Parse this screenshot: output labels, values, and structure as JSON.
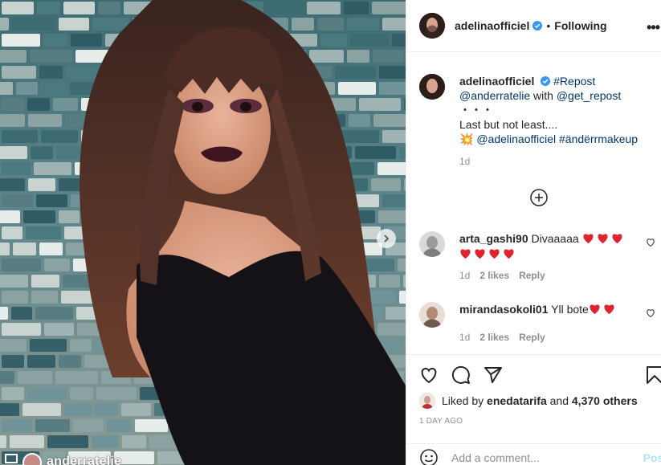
{
  "post": {
    "image_description_icon": "photo",
    "repost_credit": {
      "icon": "repost-icon",
      "username": "anderratelie"
    }
  },
  "header": {
    "username": "adelinaofficiel",
    "verified_icon": "verified-badge-icon",
    "separator": "•",
    "follow_status": "Following",
    "more_icon": "more-options-icon",
    "more_label": "•••"
  },
  "caption": {
    "username": "adelinaofficiel",
    "line1_tag": "#Repost",
    "line2_mention": "@anderratelie",
    "line2_with": "with",
    "line2_mention2": "@get_repost",
    "dots": "・・・",
    "text": "Last but not least....",
    "emoji": "💥",
    "mention3": "@adelinaofficiel",
    "hashtag": "#ändërrmakeup",
    "time": "1d"
  },
  "load_more_icon": "plus-circle-icon",
  "comments": [
    {
      "username": "arta_gashi90",
      "text": "Divaaaaa",
      "hearts_line1": 3,
      "hearts_line2": 4,
      "time": "1d",
      "likes": "2 likes",
      "reply": "Reply"
    },
    {
      "username": "mirandasokoli01",
      "text": "Yll bote",
      "hearts_line1": 2,
      "time": "1d",
      "likes": "2 likes",
      "reply": "Reply"
    }
  ],
  "actions": {
    "like_icon": "heart-icon",
    "comment_icon": "comment-icon",
    "share_icon": "send-icon",
    "save_icon": "bookmark-icon",
    "liked_by_prefix": "Liked by",
    "liked_by_user": "enedatarifa",
    "liked_by_and": "and",
    "liked_by_others": "4,370 others",
    "time_ago": "1 DAY AGO"
  },
  "add_comment": {
    "emoji_icon": "smiley-icon",
    "placeholder": "Add a comment...",
    "post_label": "Post"
  },
  "colors": {
    "link": "#00376b",
    "muted": "#8e8e8e",
    "post_disabled": "#b2dffc",
    "verified": "#3897f0",
    "heart": "#e0242f"
  }
}
